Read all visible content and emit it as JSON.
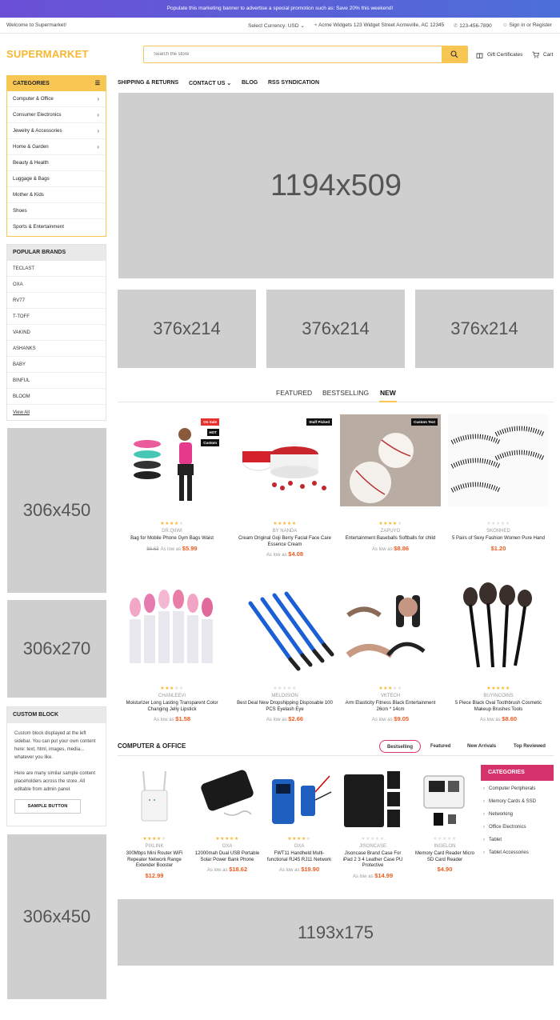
{
  "promo": {
    "text": "Populate this marketing banner to advertise a special promotion such as: Save 20% this weekend!"
  },
  "topbar": {
    "welcome": "Welcome to Supermarket!",
    "currency": "Select Currency: USD",
    "address": "Acme Widgets 123 Widget Street Acmeville, AC 12345",
    "phone": "123-456-7890",
    "account": "Sign in or Register"
  },
  "header": {
    "logo": "SUPERMARKET",
    "search_placeholder": "Search the store",
    "gift": "Gift Certificates",
    "cart": "Cart"
  },
  "nav": {
    "items": [
      "SHIPPING & RETURNS",
      "CONTACT US",
      "BLOG",
      "RSS SYNDICATION"
    ]
  },
  "categories": {
    "title": "CATEGORIES",
    "items": [
      {
        "label": "Computer & Office",
        "has_children": true
      },
      {
        "label": "Consumer Electronics",
        "has_children": true
      },
      {
        "label": "Jewelry & Accessories",
        "has_children": true
      },
      {
        "label": "Home & Garden",
        "has_children": true
      },
      {
        "label": "Beauty & Health",
        "has_children": false
      },
      {
        "label": "Luggage & Bags",
        "has_children": false
      },
      {
        "label": "Mother & Kids",
        "has_children": false
      },
      {
        "label": "Shoes",
        "has_children": false
      },
      {
        "label": "Sports & Entertainment",
        "has_children": false
      }
    ]
  },
  "brands": {
    "title": "POPULAR BRANDS",
    "items": [
      "TECLAST",
      "OXA",
      "RV77",
      "T-TOFF",
      "VAKIND",
      "ASHANKS",
      "BABY",
      "BINFUL",
      "BLOOM"
    ],
    "view_all": "View All"
  },
  "placeholders": {
    "hero": "1194x509",
    "banner1": "376x214",
    "banner2": "376x214",
    "banner3": "376x214",
    "side1": "306x450",
    "side2": "306x270",
    "side3": "306x450",
    "bottom": "1193x175"
  },
  "custom_block": {
    "title": "CUSTOM BLOCK",
    "text1": "Custom block displayed at the left sidebar. You can put your own content here: text, html, images, media... whatever you like.",
    "text2": "Here are many similar sample content placeholders across the store. All editable from admin panel.",
    "button": "SAMPLE BUTTON"
  },
  "product_tabs": [
    "FEATURED",
    "BESTSELLING",
    "NEW"
  ],
  "products": [
    {
      "brand": "DR.QIIWI",
      "name": "Bag for Mobile Phone Gym Bags Waist",
      "old_price": "$6.63",
      "as_low": "As low as",
      "price": "$5.99",
      "rating": 4,
      "badges": [
        "On Sale",
        "HOT",
        "Custom"
      ]
    },
    {
      "brand": "BY NANDA",
      "name": "Cream Original Goji Berry Facial Face Care Essence Cream",
      "old_price": "",
      "as_low": "As low as",
      "price": "$4.08",
      "rating": 5,
      "badges": [
        "Staff Picked"
      ]
    },
    {
      "brand": "ZAPUYO",
      "name": "Entertainment Baseballs Softballs for child",
      "old_price": "",
      "as_low": "As low as",
      "price": "$8.86",
      "rating": 4,
      "badges": [
        "Custom Text"
      ]
    },
    {
      "brand": "SKONHED",
      "name": "5 Pairs of Sexy Fashion Women Pure Hand",
      "old_price": "",
      "as_low": "",
      "price": "$1.20",
      "rating": 0,
      "badges": []
    },
    {
      "brand": "CHANLEEVI",
      "name": "Moisturizer Long Lasting Transparent Color Changing Jelly Lipstick",
      "old_price": "",
      "as_low": "As low as",
      "price": "$1.58",
      "rating": 3,
      "badges": []
    },
    {
      "brand": "MELOISION",
      "name": "Best Deal New Dropshipping Disposable 100 PCS Eyelash Eye",
      "old_price": "",
      "as_low": "As low as",
      "price": "$2.66",
      "rating": 0,
      "badges": []
    },
    {
      "brand": "VKTECH",
      "name": "Arm Elasticity Fitness Black Entertainment 26cm * 14cm",
      "old_price": "",
      "as_low": "As low as",
      "price": "$9.05",
      "rating": 3,
      "badges": []
    },
    {
      "brand": "BUYINCOINS",
      "name": "5 Piece Black Oval Toothbrush Cosmetic Makeup Brushes Tools",
      "old_price": "",
      "as_low": "As low as",
      "price": "$8.60",
      "rating": 5,
      "badges": []
    }
  ],
  "computer_section": {
    "title": "COMPUTER & OFFICE",
    "tabs": [
      "Bestselling",
      "Featured",
      "New Arrivals",
      "Top Reviewed"
    ],
    "products": [
      {
        "brand": "PIXLINK",
        "name": "300Mbps Mini Router WiFi Repeater Network Range Extender Booster",
        "as_low": "",
        "price": "$12.99",
        "rating": 4
      },
      {
        "brand": "OXA",
        "name": "12000mah Dual USB Portable Solar Power Bank Phone",
        "as_low": "As low as",
        "price": "$18.62",
        "rating": 5
      },
      {
        "brand": "OXA",
        "name": "FWT11 Handheld Multi-functional RJ45 RJ11 Network",
        "as_low": "As low as",
        "price": "$19.90",
        "rating": 4
      },
      {
        "brand": "JISONCASE",
        "name": "Jisoncase Brand Case For iPad 2 3 4 Leather Case PU Protective",
        "as_low": "As low as",
        "price": "$14.99",
        "rating": 0
      },
      {
        "brand": "INGELON",
        "name": "Memory Card Reader Micro SD Card Reader",
        "as_low": "",
        "price": "$4.90",
        "rating": 0
      }
    ],
    "categories_title": "CATEGORIES",
    "categories": [
      "Computer Peripherals",
      "Memory Cards & SSD",
      "Networking",
      "Office Electronics",
      "Tablet",
      "Tablet Accessories"
    ]
  },
  "colors": {
    "accent": "#f7c653",
    "price": "#e95d23",
    "pink": "#d6336c",
    "placeholder": "#cfcfcf"
  }
}
